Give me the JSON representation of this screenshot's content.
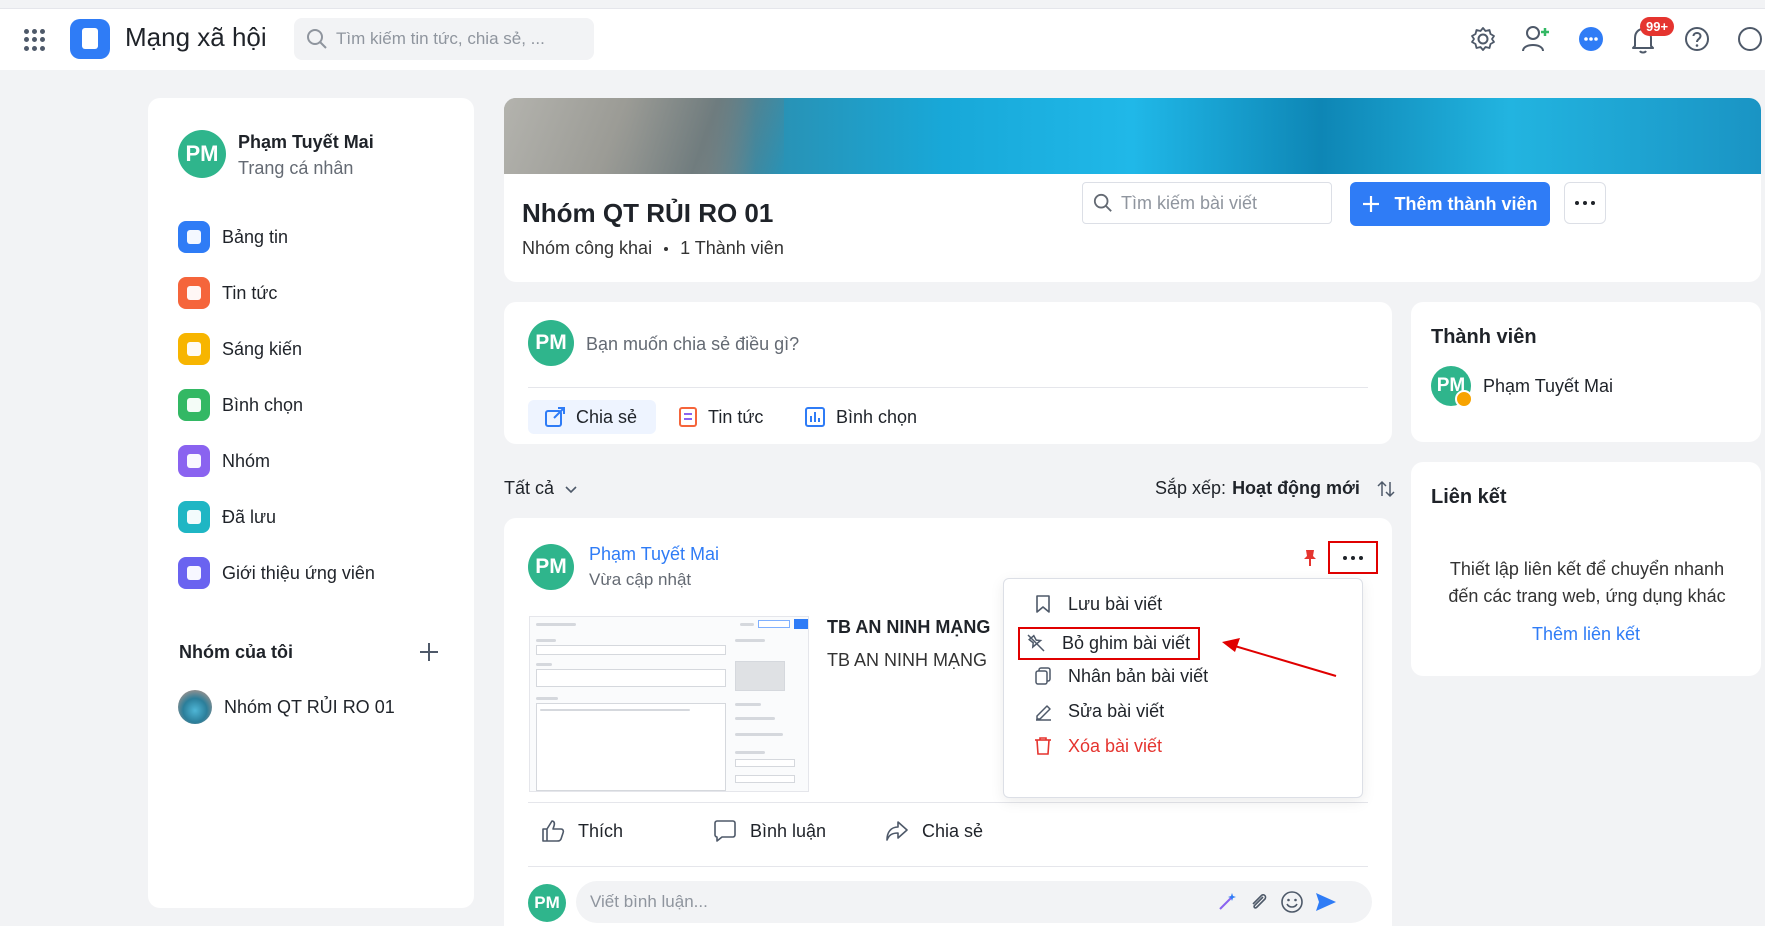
{
  "topbar": {
    "app_title": "Mạng xã hội",
    "search_placeholder": "Tìm kiếm tin tức, chia sẻ, ...",
    "notification_badge": "99+"
  },
  "profile": {
    "initials": "PM",
    "name": "Phạm Tuyết Mai",
    "subtitle": "Trang cá nhân"
  },
  "sidebar": {
    "items": [
      {
        "label": "Bảng tin",
        "icon": "feed-icon",
        "color": "#2f7cf6"
      },
      {
        "label": "Tin tức",
        "icon": "news-icon",
        "color": "#f5653b"
      },
      {
        "label": "Sáng kiến",
        "icon": "lightbulb-icon",
        "color": "#f7b500"
      },
      {
        "label": "Bình chọn",
        "icon": "poll-icon",
        "color": "#33b864"
      },
      {
        "label": "Nhóm",
        "icon": "group-icon",
        "color": "#8a63f0"
      },
      {
        "label": "Đã lưu",
        "icon": "bookmark-icon",
        "color": "#1fb6c4"
      },
      {
        "label": "Giới thiệu ứng viên",
        "icon": "candidate-icon",
        "color": "#6a63f0"
      }
    ],
    "my_groups_title": "Nhóm của tôi",
    "groups": [
      {
        "label": "Nhóm QT RỦI RO 01"
      }
    ]
  },
  "group": {
    "name": "Nhóm QT RỦI RO 01",
    "privacy": "Nhóm công khai",
    "members_count": "1 Thành viên",
    "search_placeholder": "Tìm kiếm bài viết",
    "add_member_label": "Thêm thành viên"
  },
  "composer": {
    "initials": "PM",
    "placeholder": "Bạn muốn chia sẻ điều gì?",
    "tabs": [
      {
        "label": "Chia sẻ",
        "icon": "share-edit-icon",
        "color": "#2f7cf6"
      },
      {
        "label": "Tin tức",
        "icon": "news-icon",
        "color": "#f5653b"
      },
      {
        "label": "Bình chọn",
        "icon": "poll-icon",
        "color": "#2f7cf6"
      }
    ]
  },
  "feed_filter": {
    "filter_label": "Tất cả",
    "sort_prefix": "Sắp xếp:",
    "sort_value": "Hoạt động mới"
  },
  "post": {
    "initials": "PM",
    "author": "Phạm Tuyết Mai",
    "time": "Vừa cập nhật",
    "title": "TB AN NINH MẠNG",
    "body": "TB AN NINH MẠNG",
    "actions": [
      {
        "label": "Thích",
        "icon": "thumbs-up-icon"
      },
      {
        "label": "Bình luận",
        "icon": "comment-icon"
      },
      {
        "label": "Chia sẻ",
        "icon": "share-icon"
      }
    ],
    "comment_placeholder": "Viết bình luận..."
  },
  "post_menu": {
    "items": [
      {
        "label": "Lưu bài viết",
        "icon": "bookmark-icon",
        "danger": false
      },
      {
        "label": "Bỏ ghim bài viết",
        "icon": "unpin-icon",
        "danger": false
      },
      {
        "label": "Nhân bản bài viết",
        "icon": "copy-icon",
        "danger": false
      },
      {
        "label": "Sửa bài viết",
        "icon": "edit-icon",
        "danger": false
      },
      {
        "label": "Xóa bài viết",
        "icon": "trash-icon",
        "danger": true
      }
    ]
  },
  "members_panel": {
    "title": "Thành viên",
    "members": [
      {
        "initials": "PM",
        "name": "Phạm Tuyết Mai"
      }
    ]
  },
  "links_panel": {
    "title": "Liên kết",
    "description": "Thiết lập liên kết để chuyển nhanh đến các trang web, ứng dụng khác",
    "add_label": "Thêm liên kết"
  },
  "colors": {
    "accent": "#2f7cf6",
    "avatar": "#2fb58c",
    "danger": "#e5342f",
    "highlight": "#e00000"
  }
}
